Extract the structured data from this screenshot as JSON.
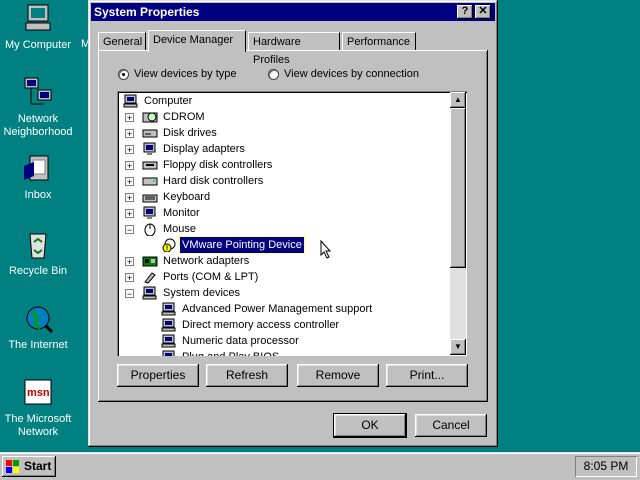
{
  "desktop": {
    "icons": [
      {
        "label": "My Computer",
        "icon": "my-computer-icon"
      },
      {
        "label": "Network Neighborhood",
        "icon": "network-icon"
      },
      {
        "label": "Inbox",
        "icon": "inbox-icon"
      },
      {
        "label": "Recycle Bin",
        "icon": "recycle-bin-icon"
      },
      {
        "label": "The Internet",
        "icon": "internet-icon"
      },
      {
        "label": "The Microsoft Network",
        "icon": "msn-icon"
      }
    ],
    "partial_label": "M"
  },
  "window": {
    "title": "System Properties",
    "help_glyph": "?",
    "close_glyph": "✕",
    "tabs": [
      {
        "label": "General"
      },
      {
        "label": "Device Manager",
        "active": true
      },
      {
        "label": "Hardware Profiles"
      },
      {
        "label": "Performance"
      }
    ],
    "view_by_type": "View devices by type",
    "view_by_connection": "View devices by connection",
    "selected_view": "type",
    "tree": [
      {
        "label": "Computer",
        "level": 0,
        "expander": "",
        "icon": "computer-icon"
      },
      {
        "label": "CDROM",
        "level": 1,
        "expander": "+",
        "icon": "cdrom-icon"
      },
      {
        "label": "Disk drives",
        "level": 1,
        "expander": "+",
        "icon": "disk-drive-icon"
      },
      {
        "label": "Display adapters",
        "level": 1,
        "expander": "+",
        "icon": "monitor-icon"
      },
      {
        "label": "Floppy disk controllers",
        "level": 1,
        "expander": "+",
        "icon": "floppy-controller-icon"
      },
      {
        "label": "Hard disk controllers",
        "level": 1,
        "expander": "+",
        "icon": "hard-disk-controller-icon"
      },
      {
        "label": "Keyboard",
        "level": 1,
        "expander": "+",
        "icon": "keyboard-icon"
      },
      {
        "label": "Monitor",
        "level": 1,
        "expander": "+",
        "icon": "monitor-icon"
      },
      {
        "label": "Mouse",
        "level": 1,
        "expander": "−",
        "icon": "mouse-icon"
      },
      {
        "label": "VMware Pointing Device",
        "level": 2,
        "expander": "",
        "icon": "warning-mouse-icon",
        "selected": true
      },
      {
        "label": "Network adapters",
        "level": 1,
        "expander": "+",
        "icon": "network-adapter-icon"
      },
      {
        "label": "Ports (COM & LPT)",
        "level": 1,
        "expander": "+",
        "icon": "port-icon"
      },
      {
        "label": "System devices",
        "level": 1,
        "expander": "−",
        "icon": "computer-icon"
      },
      {
        "label": "Advanced Power Management support",
        "level": 2,
        "expander": "",
        "icon": "system-device-icon"
      },
      {
        "label": "Direct memory access controller",
        "level": 2,
        "expander": "",
        "icon": "system-device-icon"
      },
      {
        "label": "Numeric data processor",
        "level": 2,
        "expander": "",
        "icon": "system-device-icon"
      },
      {
        "label": "Plug and Play BIOS",
        "level": 2,
        "expander": "",
        "icon": "system-device-icon"
      }
    ],
    "buttons": {
      "properties": "Properties",
      "refresh": "Refresh",
      "remove": "Remove",
      "print": "Print...",
      "ok": "OK",
      "cancel": "Cancel"
    }
  },
  "taskbar": {
    "start_label": "Start",
    "clock": "8:05 PM"
  }
}
